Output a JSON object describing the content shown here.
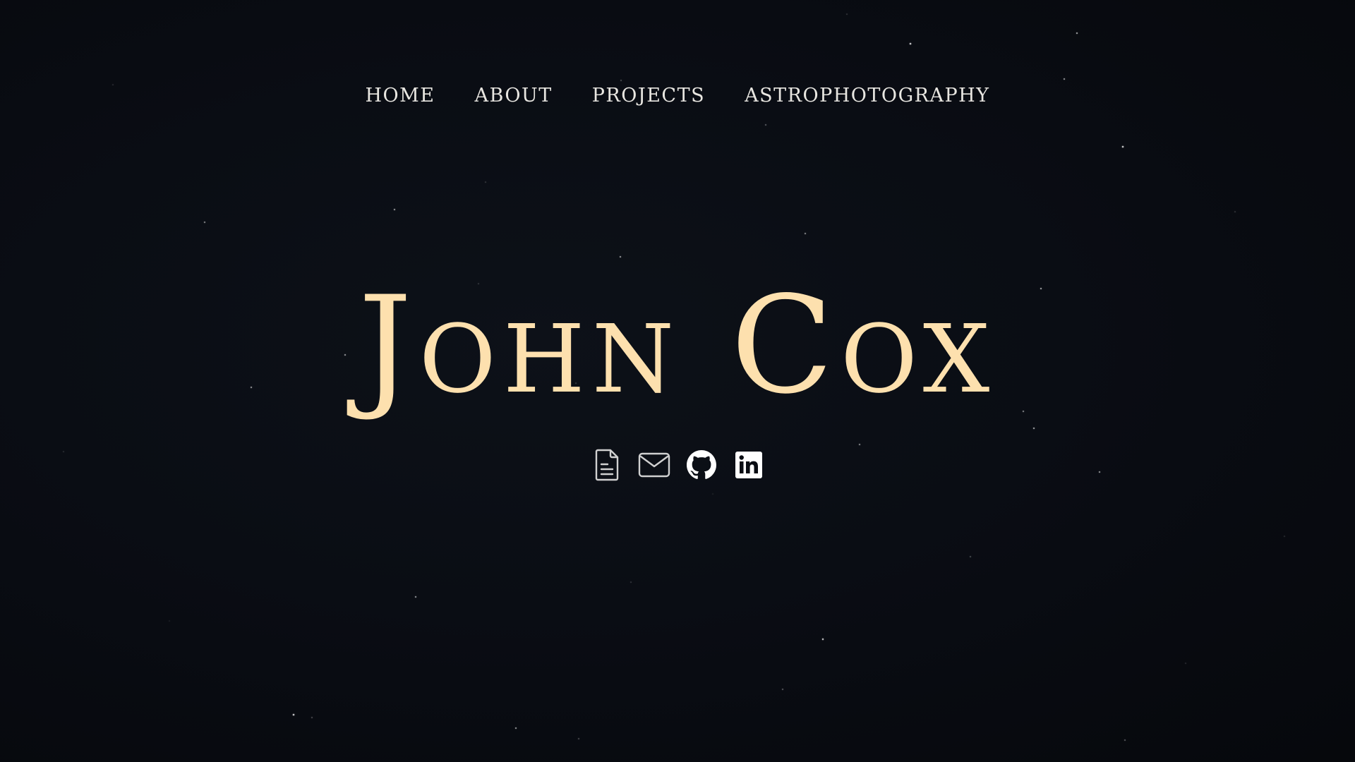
{
  "nav": {
    "items": [
      {
        "label": "HOME"
      },
      {
        "label": "ABOUT"
      },
      {
        "label": "PROJECTS"
      },
      {
        "label": "ASTROPHOTOGRAPHY"
      }
    ]
  },
  "hero": {
    "title": "John Cox"
  },
  "social": {
    "icons": [
      "document-icon",
      "mail-icon",
      "github-icon",
      "linkedin-icon"
    ]
  },
  "colors": {
    "background": "#0a0d14",
    "title": "#fde0ae",
    "nav_text": "#e8e6e1",
    "icon_outline": "#d0d0d0",
    "icon_solid": "#ffffff"
  }
}
